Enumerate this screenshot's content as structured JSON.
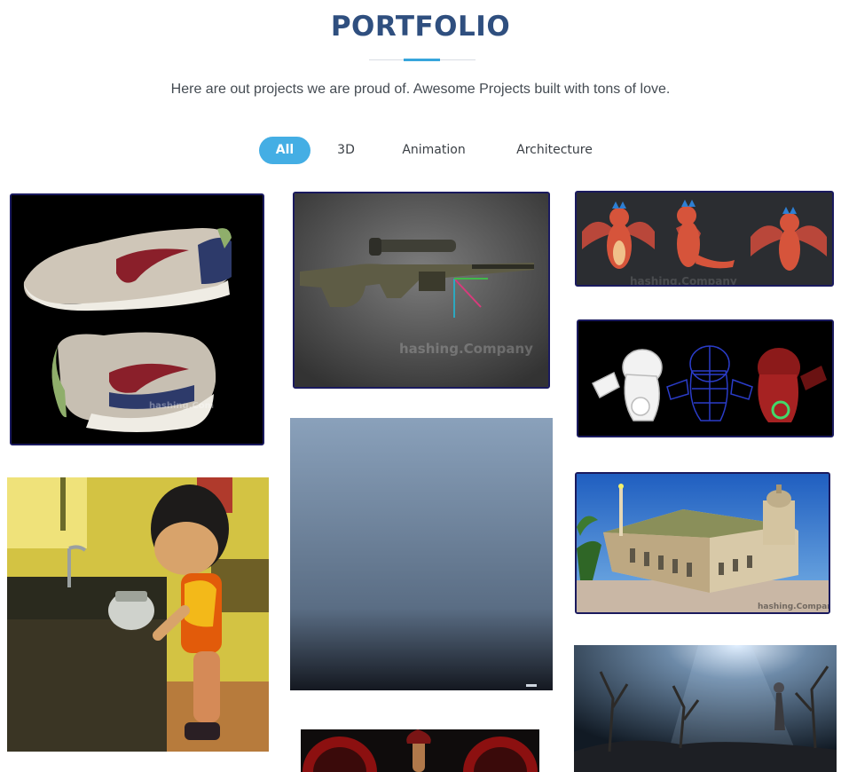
{
  "header": {
    "title": "PORTFOLIO",
    "subtitle": "Here are out projects we are proud of. Awesome Projects built with tons of love."
  },
  "filters": [
    {
      "label": "All",
      "active": true
    },
    {
      "label": "3D",
      "active": false
    },
    {
      "label": "Animation",
      "active": false
    },
    {
      "label": "Architecture",
      "active": false
    }
  ],
  "watermark": "hashing.Company",
  "colors": {
    "title": "#2f4f7f",
    "accent": "#44aee4",
    "tile_border": "#1a1a5e"
  }
}
